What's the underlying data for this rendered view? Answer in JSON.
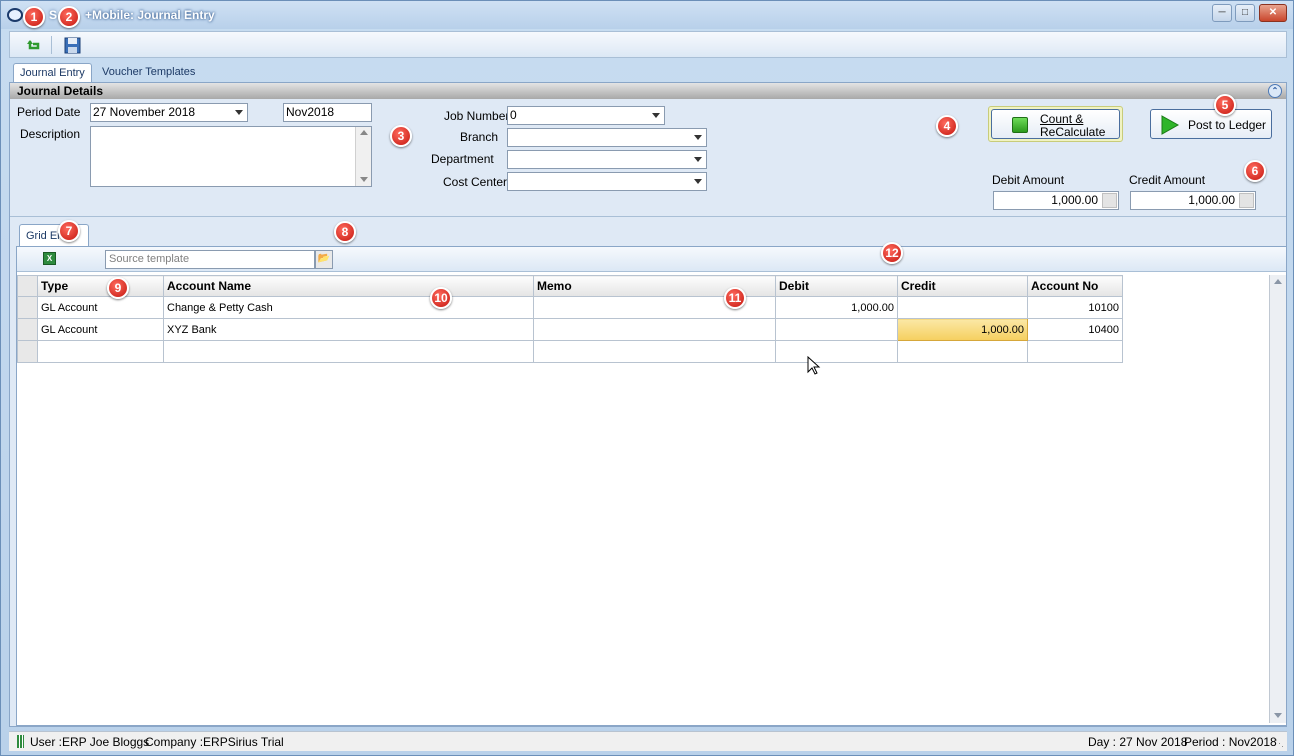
{
  "window": {
    "title": "+Mobile: Journal Entry",
    "title_prefix": "S",
    "controls": [
      "minimize",
      "maximize",
      "close"
    ]
  },
  "toolbar": {
    "icons": [
      "undo-icon",
      "save-icon"
    ]
  },
  "tabs": [
    {
      "label": "Journal Entry",
      "active": true
    },
    {
      "label": "Voucher Templates",
      "active": false
    }
  ],
  "journal_details": {
    "header": "Journal Details",
    "period_date_label": "Period Date",
    "period_date_value": "27 November 2018",
    "period_code": "Nov2018",
    "description_label": "Description",
    "description_value": "",
    "job_number_label": "Job Number",
    "job_number_value": "0",
    "branch_label": "Branch",
    "branch_value": "",
    "department_label": "Department",
    "department_value": "",
    "cost_center_label": "Cost Center",
    "cost_center_value": "",
    "count_button_line1": "Count &",
    "count_button_line2": "ReCalculate",
    "post_button_label": "Post to Ledger",
    "debit_amount_label": "Debit Amount",
    "debit_amount_value": "1,000.00",
    "credit_amount_label": "Credit Amount",
    "credit_amount_value": "1,000.00"
  },
  "grid": {
    "tab_label": "Grid Entry",
    "source_template_placeholder": "Source template",
    "columns": [
      "Type",
      "Account Name",
      "Memo",
      "Debit",
      "Credit",
      "Account No"
    ],
    "rows": [
      {
        "type": "GL Account",
        "account_name": "Change & Petty Cash",
        "memo": "",
        "debit": "1,000.00",
        "credit": "",
        "account_no": "10100"
      },
      {
        "type": "GL Account",
        "account_name": "XYZ Bank",
        "memo": "",
        "debit": "",
        "credit": "1,000.00",
        "account_no": "10400"
      },
      {
        "type": "",
        "account_name": "",
        "memo": "",
        "debit": "",
        "credit": "",
        "account_no": ""
      }
    ]
  },
  "status": {
    "user": "User :ERP Joe Bloggs",
    "company": "Company :ERPSirius Trial",
    "day": "Day : 27 Nov 2018",
    "period": "Period : Nov2018"
  },
  "badges": [
    "1",
    "2",
    "3",
    "4",
    "5",
    "6",
    "7",
    "8",
    "9",
    "10",
    "11",
    "12"
  ],
  "colors": {
    "badge_red": "#d42a1e",
    "selected_cell": "#f5cf5f",
    "titlebar": "#b8d0ea"
  }
}
